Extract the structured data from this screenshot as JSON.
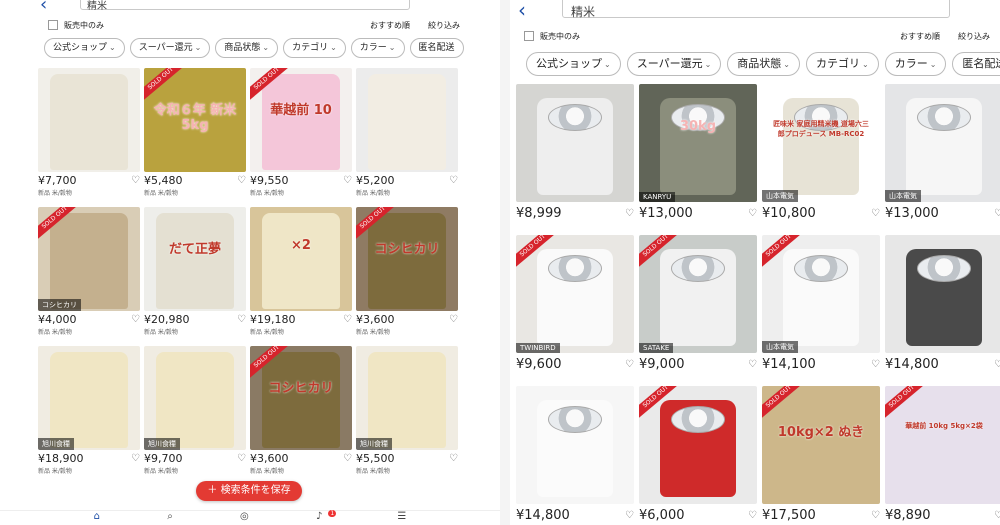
{
  "left": {
    "search_value": "精米",
    "filter_onsale": "販売中のみ",
    "sort_label": "おすすめ順",
    "filter_label": "絞り込み",
    "chips": [
      "公式ショップ",
      "スーパー還元",
      "商品状態",
      "カテゴリ",
      "カラー",
      "匿名配送"
    ],
    "items": [
      {
        "price": "¥7,700",
        "sub": "新品 米/穀物",
        "sold": false,
        "tag": "",
        "overlay": ""
      },
      {
        "price": "¥5,480",
        "sub": "新品 米/穀物",
        "sold": true,
        "tag": "",
        "overlay": "令和６年 新米 5kg"
      },
      {
        "price": "¥9,550",
        "sub": "新品 米/穀物",
        "sold": true,
        "tag": "",
        "overlay": "華越前 10"
      },
      {
        "price": "¥5,200",
        "sub": "新品 米/穀物",
        "sold": false,
        "tag": "",
        "overlay": ""
      },
      {
        "price": "¥4,000",
        "sub": "新品 米/穀物",
        "sold": true,
        "tag": "コシヒカリ",
        "overlay": ""
      },
      {
        "price": "¥20,980",
        "sub": "新品 米/穀物",
        "sold": false,
        "tag": "",
        "overlay": "だて正夢"
      },
      {
        "price": "¥19,180",
        "sub": "新品 米/穀物",
        "sold": false,
        "tag": "",
        "overlay": "×2"
      },
      {
        "price": "¥3,600",
        "sub": "新品 米/穀物",
        "sold": true,
        "tag": "",
        "overlay": "コシヒカリ"
      },
      {
        "price": "¥18,900",
        "sub": "新品 米/穀物",
        "sold": false,
        "tag": "旭川食糧",
        "overlay": ""
      },
      {
        "price": "¥9,700",
        "sub": "新品 米/穀物",
        "sold": false,
        "tag": "旭川食糧",
        "overlay": ""
      },
      {
        "price": "¥3,600",
        "sub": "新品 米/穀物",
        "sold": true,
        "tag": "",
        "overlay": "コシヒカリ"
      },
      {
        "price": "¥5,500",
        "sub": "新品 米/穀物",
        "sold": false,
        "tag": "旭川食糧",
        "overlay": ""
      }
    ],
    "save_button": "検索条件を保存",
    "notification_count": "1"
  },
  "right": {
    "search_value": "精米",
    "filter_onsale": "販売中のみ",
    "sort_label": "おすすめ順",
    "filter_label": "絞り込み",
    "chips": [
      "公式ショップ",
      "スーパー還元",
      "商品状態",
      "カテゴリ",
      "カラー",
      "匿名配送"
    ],
    "items": [
      {
        "price": "¥8,999",
        "sold": false,
        "tag": "",
        "overlay": ""
      },
      {
        "price": "¥13,000",
        "sold": false,
        "tag": "KANRYU",
        "overlay": "30kg"
      },
      {
        "price": "¥10,800",
        "sold": false,
        "tag": "山本電気",
        "overlay": "匠味米 家庭用精米機 道場六三郎プロデュース MB-RC02"
      },
      {
        "price": "¥13,000",
        "sold": false,
        "tag": "山本電気",
        "overlay": ""
      },
      {
        "price": "¥9,600",
        "sold": true,
        "tag": "TWINBIRD",
        "overlay": ""
      },
      {
        "price": "¥9,000",
        "sold": true,
        "tag": "SATAKE",
        "overlay": ""
      },
      {
        "price": "¥14,100",
        "sold": true,
        "tag": "山本電気",
        "overlay": ""
      },
      {
        "price": "¥14,800",
        "sold": false,
        "tag": "",
        "overlay": ""
      },
      {
        "price": "¥14,800",
        "sold": false,
        "tag": "",
        "overlay": ""
      },
      {
        "price": "¥6,000",
        "sold": true,
        "tag": "",
        "overlay": ""
      },
      {
        "price": "¥17,500",
        "sold": true,
        "tag": "",
        "overlay": "10kg×2 ぬき"
      },
      {
        "price": "¥8,890",
        "sold": true,
        "tag": "",
        "overlay": "華越前 10kg 5kg×2袋"
      }
    ]
  },
  "sold_label": "SOLD OUT",
  "colors": {
    "accent": "#e33a33",
    "link": "#1d4ea6",
    "sold": "#d6242c"
  }
}
